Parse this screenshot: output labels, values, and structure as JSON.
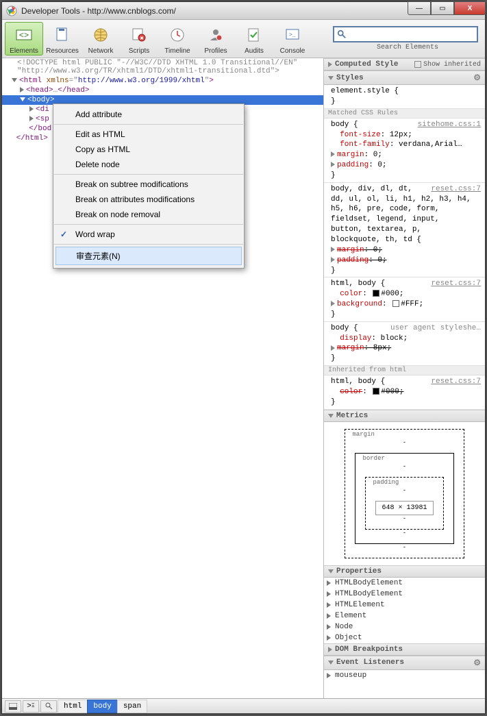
{
  "window": {
    "title": "Developer Tools - http://www.cnblogs.com/",
    "controls": {
      "min": "—",
      "max": "▭",
      "close": "X"
    }
  },
  "toolbar": {
    "items": [
      {
        "label": "Elements",
        "icon": "◇"
      },
      {
        "label": "Resources",
        "icon": "🗎"
      },
      {
        "label": "Network",
        "icon": "◉"
      },
      {
        "label": "Scripts",
        "icon": "{}"
      },
      {
        "label": "Timeline",
        "icon": "🕒"
      },
      {
        "label": "Profiles",
        "icon": "👤"
      },
      {
        "label": "Audits",
        "icon": "✓"
      },
      {
        "label": "Console",
        "icon": ">_"
      }
    ],
    "search_placeholder": "",
    "search_caption": "Search Elements"
  },
  "dom": {
    "doctype": "<!DOCTYPE html PUBLIC \"-//W3C//DTD XHTML 1.0 Transitional//EN\" \"http://www.w3.org/TR/xhtml1/DTD/xhtml1-transitional.dtd\">",
    "html_open": "<html xmlns=\"http://www.w3.org/1999/xhtml\">",
    "head": "<head>…</head>",
    "body": "<body>",
    "div": "<div",
    "spa": "<spa",
    "body_close": "</body",
    "html_close": "</html>"
  },
  "context_menu": {
    "items": [
      "Add attribute",
      "Edit as HTML",
      "Copy as HTML",
      "Delete node",
      "Break on subtree modifications",
      "Break on attributes modifications",
      "Break on node removal",
      "Word wrap",
      "审查元素(N)"
    ]
  },
  "sidebar": {
    "computed_style": "Computed Style",
    "show_inherited": "Show inherited",
    "styles": "Styles",
    "element_style": "element.style {",
    "brace_close": "}",
    "matched_rules": "Matched CSS Rules",
    "rule1": {
      "selector": "body {",
      "src": "sitehome.css:1",
      "p1": "font-size",
      "v1": ": 12px;",
      "p2": "font-family",
      "v2": ": verdana,Arial…",
      "p3": "margin",
      "v3": ": 0;",
      "p4": "padding",
      "v4": ": 0;"
    },
    "rule2": {
      "selector": "body, div, dl, dt,",
      "src": "reset.css:7",
      "line2": "dd, ul, ol, li, h1, h2, h3, h4,",
      "line3": "h5, h6, pre, code, form,",
      "line4": "fieldset, legend, input,",
      "line5": "button, textarea, p,",
      "line6": "blockquote, th, td {",
      "p1": "margin",
      "v1": ": 0;",
      "p2": "padding",
      "v2": ": 0;"
    },
    "rule3": {
      "selector": "html, body {",
      "src": "reset.css:7",
      "p1": "color",
      "v1": "#000;",
      "p2": "background",
      "v2": "#FFF;"
    },
    "rule4": {
      "selector": "body {",
      "src": "user agent styleshe…",
      "p1": "display",
      "v1": ": block;",
      "p2": "margin",
      "v2": ": 8px;"
    },
    "inherited": "Inherited from html",
    "rule5": {
      "selector": "html, body {",
      "src": "reset.css:7",
      "p1": "color",
      "v1": "#000;"
    },
    "metrics": "Metrics",
    "metrics_data": {
      "margin": "margin",
      "border": "border",
      "padding": "padding",
      "content": "648 × 13981",
      "dash": "-"
    },
    "properties": "Properties",
    "prop_items": [
      "HTMLBodyElement",
      "HTMLBodyElement",
      "HTMLElement",
      "Element",
      "Node",
      "Object"
    ],
    "dom_breakpoints": "DOM Breakpoints",
    "event_listeners": "Event Listeners",
    "listeners": [
      "mouseup"
    ]
  },
  "statusbar": {
    "crumbs": [
      "html",
      "body",
      "span"
    ]
  }
}
